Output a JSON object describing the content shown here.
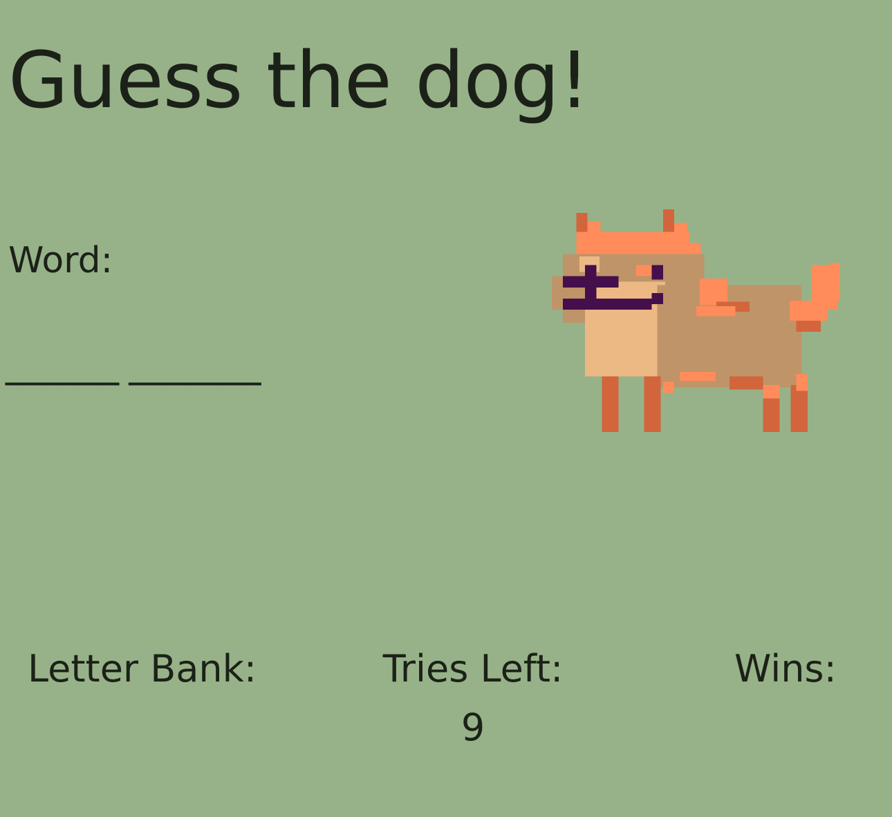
{
  "title": "Guess the dog!",
  "word": {
    "label": "Word:",
    "blanks": "______ _______"
  },
  "dog_image": {
    "icon": "pixel-dog-icon",
    "colors": {
      "fur_tan": "#bf9469",
      "fur_light": "#ecb985",
      "orange": "#ff8c5a",
      "orange_dark": "#d2653c",
      "sunglasses": "#440f4b"
    }
  },
  "stats": {
    "letter_bank": {
      "label": "Letter Bank:",
      "value": ""
    },
    "tries_left": {
      "label": "Tries Left:",
      "value": "9"
    },
    "wins": {
      "label": "Wins:",
      "value": ""
    }
  },
  "colors": {
    "background": "#97b288",
    "text": "#1b2118"
  }
}
